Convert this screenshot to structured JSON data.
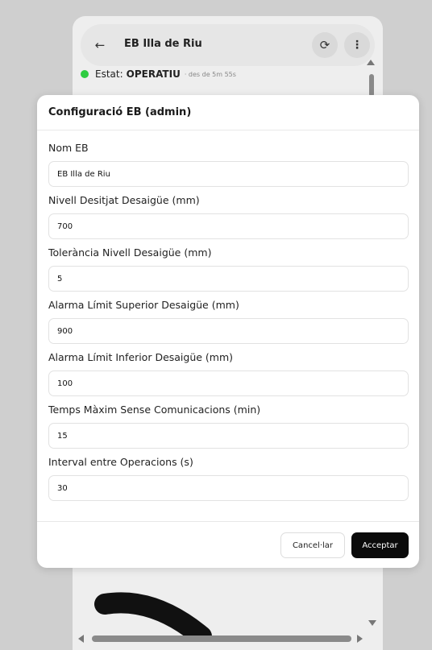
{
  "app": {
    "title": "EB Illa de Riu",
    "status_label": "Estat:",
    "status_value": "OPERATIU",
    "status_since": "· des de 5m 55s",
    "status_color": "#2ecc40",
    "icons": {
      "back": "arrow-left-icon",
      "refresh": "refresh-icon",
      "menu": "kebab-menu-icon"
    }
  },
  "modal": {
    "title": "Configuració EB (admin)",
    "fields": [
      {
        "label": "Nom EB",
        "value": "EB Illa de Riu"
      },
      {
        "label": "Nivell Desitjat Desaigüe (mm)",
        "value": "700"
      },
      {
        "label": "Tolerància Nivell Desaigüe (mm)",
        "value": "5"
      },
      {
        "label": "Alarma Límit Superior Desaigüe (mm)",
        "value": "900"
      },
      {
        "label": "Alarma Límit Inferior Desaigüe (mm)",
        "value": "100"
      },
      {
        "label": "Temps Màxim Sense Comunicacions (min)",
        "value": "15"
      },
      {
        "label": "Interval entre Operacions (s)",
        "value": "30"
      }
    ],
    "cancel_label": "Cancel·lar",
    "accept_label": "Acceptar",
    "accept_color": "#0b0b0b"
  }
}
